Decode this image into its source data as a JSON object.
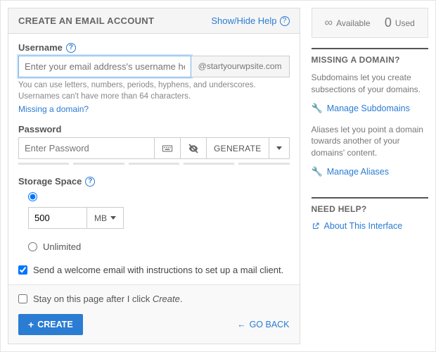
{
  "header": {
    "title": "CREATE AN EMAIL ACCOUNT",
    "help_link": "Show/Hide Help"
  },
  "username": {
    "label": "Username",
    "placeholder": "Enter your email address's username here.",
    "domain": "@startyourwpsite.com",
    "hint": "You can use letters, numbers, periods, hyphens, and underscores. Usernames can't have more than 64 characters.",
    "missing_link": "Missing a domain?"
  },
  "password": {
    "label": "Password",
    "placeholder": "Enter Password",
    "generate": "GENERATE"
  },
  "storage": {
    "label": "Storage Space",
    "value": "500",
    "unit": "MB",
    "unlimited_label": "Unlimited"
  },
  "welcome": {
    "label": "Send a welcome email with instructions to set up a mail client."
  },
  "footer": {
    "stay_prefix": "Stay on this page after I click ",
    "stay_em": "Create",
    "stay_suffix": ".",
    "create": "CREATE",
    "back": "GO BACK"
  },
  "stats": {
    "available_label": "Available",
    "used_value": "0",
    "used_label": "Used"
  },
  "side_domain": {
    "title": "MISSING A DOMAIN?",
    "sub_text": "Subdomains let you create subsections of your domains.",
    "sub_link": "Manage Subdomains",
    "alias_text": "Aliases let you point a domain towards another of your domains' content.",
    "alias_link": "Manage Aliases"
  },
  "side_help": {
    "title": "NEED HELP?",
    "about_link": "About This Interface"
  }
}
